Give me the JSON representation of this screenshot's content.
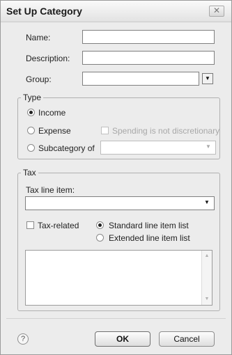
{
  "dialog": {
    "title": "Set Up Category",
    "close_glyph": "✕"
  },
  "form": {
    "name_label": "Name:",
    "name_value": "",
    "description_label": "Description:",
    "description_value": "",
    "group_label": "Group:",
    "group_value": "",
    "group_dropdown_glyph": "▼"
  },
  "type_group": {
    "legend": "Type",
    "income_label": "Income",
    "expense_label": "Expense",
    "subcategory_label": "Subcategory of",
    "spending_label": "Spending is not discretionary",
    "subcategory_value": "",
    "subcategory_dropdown_glyph": "▼",
    "selected": "Income"
  },
  "tax_group": {
    "legend": "Tax",
    "line_item_label": "Tax line item:",
    "line_item_value": "",
    "line_item_dropdown_glyph": "▼",
    "tax_related_label": "Tax-related",
    "standard_label": "Standard line item list",
    "extended_label": "Extended line item list",
    "selected_list": "Standard line item list",
    "scroll_up_glyph": "▲",
    "scroll_down_glyph": "▼"
  },
  "footer": {
    "help_glyph": "?",
    "ok_label": "OK",
    "cancel_label": "Cancel"
  },
  "icons": {
    "close": "close-icon",
    "help": "help-icon",
    "dropdown": "chevron-down-icon"
  }
}
